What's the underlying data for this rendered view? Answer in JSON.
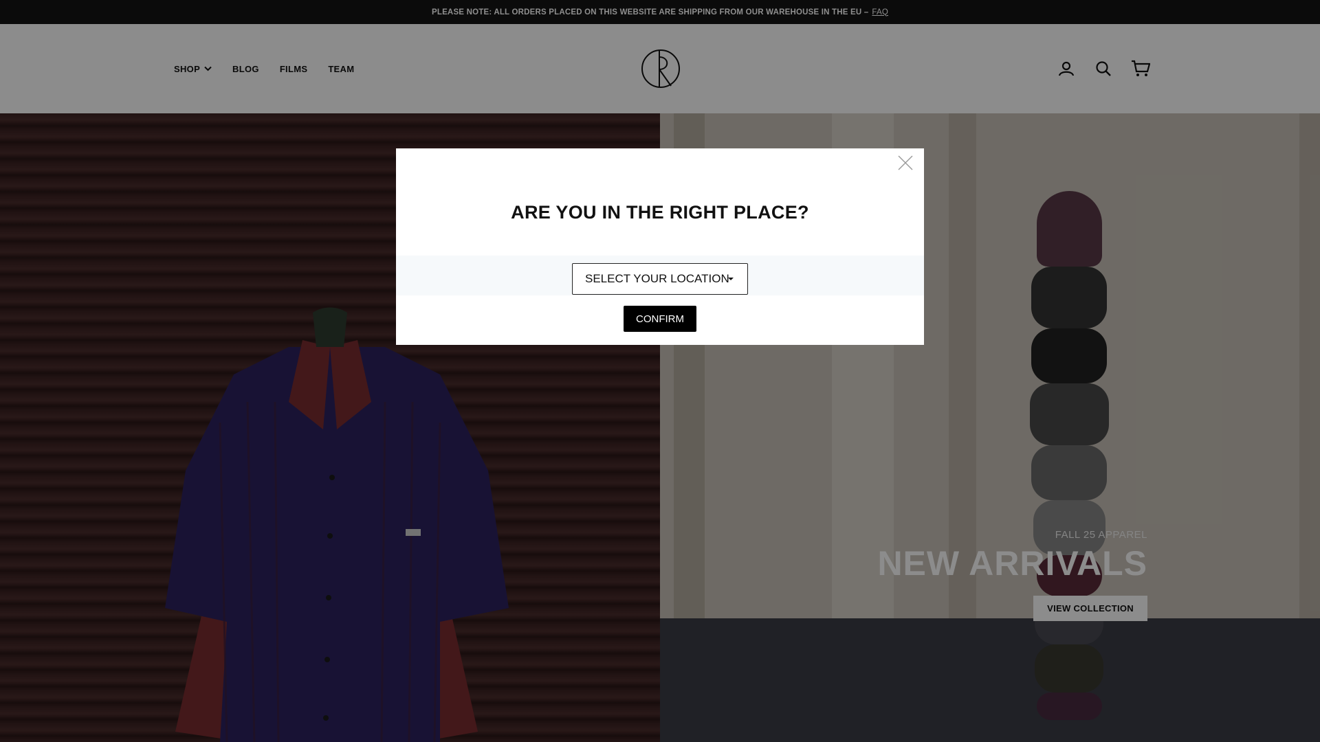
{
  "announcement": {
    "text": "PLEASE NOTE: ALL ORDERS PLACED ON THIS WEBSITE ARE SHIPPING FROM OUR WAREHOUSE IN THE EU –",
    "link": "FAQ"
  },
  "header": {
    "nav": [
      "SHOP",
      "BLOG",
      "FILMS",
      "TEAM"
    ],
    "icons": [
      "account-icon",
      "search-icon",
      "cart-icon"
    ]
  },
  "hero": {
    "subtitle": "FALL 25 APPAREL",
    "title": "NEW ARRIVALS",
    "button": "VIEW COLLECTION"
  },
  "modal": {
    "title": "ARE YOU IN THE RIGHT PLACE?",
    "select_value": "SELECT YOUR LOCATION",
    "confirm_label": "CONFIRM"
  },
  "colors": {
    "overlay": "#000000",
    "button": "#000000",
    "accent_band": "#f6f9fb"
  }
}
